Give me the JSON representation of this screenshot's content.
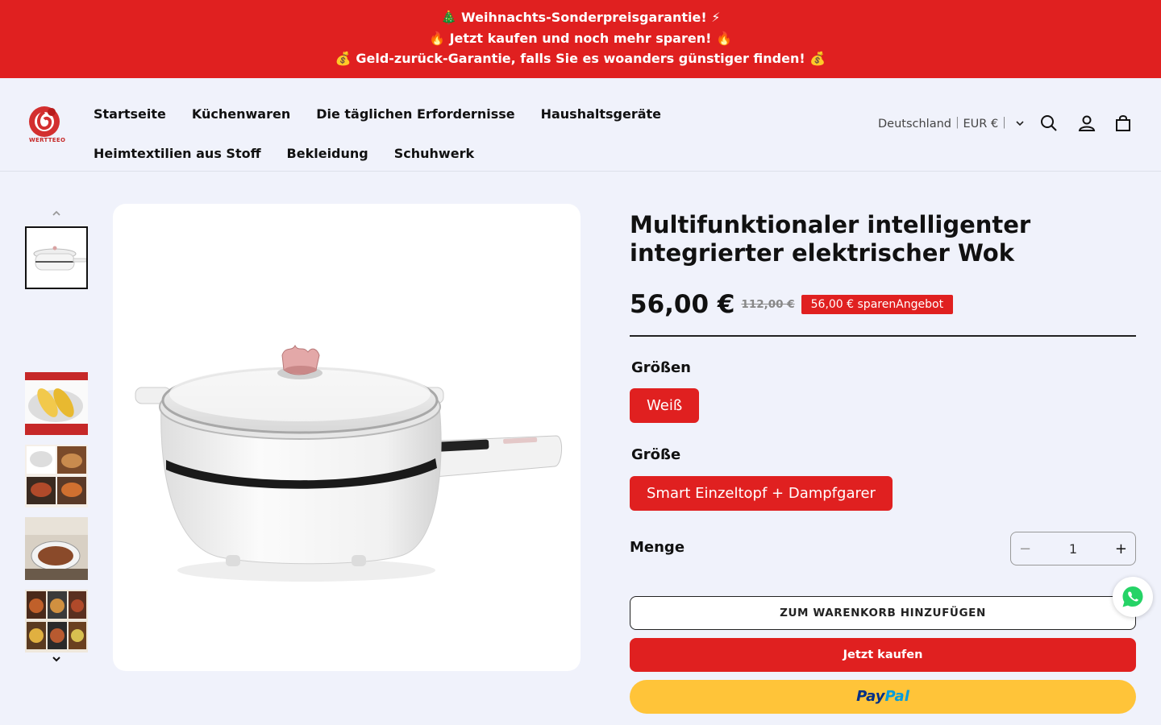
{
  "announcement": {
    "lines": [
      "🎄 Weihnachts-Sonderpreisgarantie! ⚡",
      "🔥 Jetzt kaufen und noch mehr sparen! 🔥",
      "💰 Geld-zurück-Garantie, falls Sie es woanders günstiger finden! 💰"
    ]
  },
  "header": {
    "logo_text": "WERTTEEO",
    "nav": {
      "row1": [
        "Startseite",
        "Küchenwaren",
        "Die täglichen Erfordernisse",
        "Haushaltsgeräte"
      ],
      "row2": [
        "Heimtextilien aus Stoff",
        "Bekleidung",
        "Schuhwerk"
      ]
    },
    "country_selector": "Deutschland｜EUR €｜",
    "icons": [
      "search-icon",
      "account-icon",
      "cart-icon",
      "chevron-down-icon"
    ]
  },
  "gallery": {
    "thumbnail_count": 5,
    "active_index": 0
  },
  "product": {
    "title": "Multifunktionaler intelligenter integrierter elektrischer Wok",
    "price": "56,00 €",
    "compare_price": "112,00 €",
    "badge": "56,00 € sparenAngebot",
    "option1_label": "Größen",
    "option1_value": "Weiß",
    "option2_label": "Größe",
    "option2_value": "Smart Einzeltopf + Dampfgarer",
    "quantity_label": "Menge",
    "quantity_minus": "−",
    "quantity": "1",
    "quantity_plus": "+",
    "add_to_cart": "ZUM WARENKORB HINZUFÜGEN",
    "buy_now": "Jetzt kaufen",
    "paypal_1": "Pay",
    "paypal_2": "Pal"
  },
  "colors": {
    "accent": "#e02020",
    "paypal": "#ffc439",
    "page_bg": "#f0f2fb"
  }
}
